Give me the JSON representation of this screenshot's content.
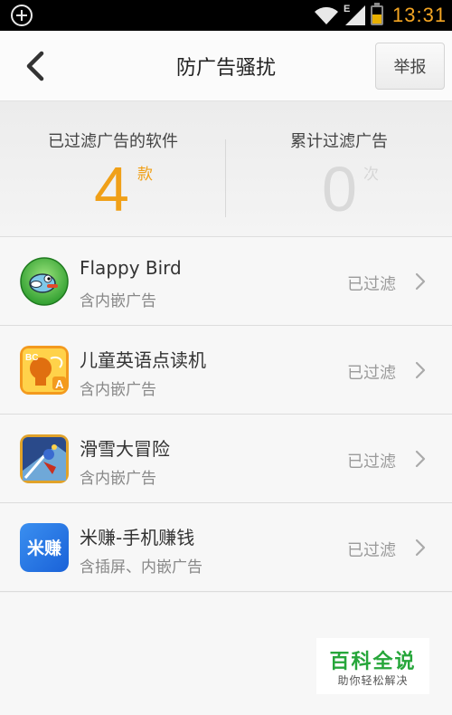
{
  "status_bar": {
    "time": "13:31",
    "network": "E"
  },
  "header": {
    "title": "防广告骚扰",
    "report_button": "举报"
  },
  "stats": {
    "filtered_apps": {
      "label": "已过滤广告的软件",
      "value": "4",
      "unit": "款"
    },
    "total_filtered": {
      "label": "累计过滤广告",
      "value": "0",
      "unit": "次"
    }
  },
  "apps": [
    {
      "name": "Flappy Bird",
      "ad_type": "含内嵌广告",
      "status": "已过滤",
      "icon": "flappy-bird-icon"
    },
    {
      "name": "儿童英语点读机",
      "ad_type": "含内嵌广告",
      "status": "已过滤",
      "icon": "kids-english-icon"
    },
    {
      "name": "滑雪大冒险",
      "ad_type": "含内嵌广告",
      "status": "已过滤",
      "icon": "ski-adventure-icon"
    },
    {
      "name": "米赚-手机赚钱",
      "ad_type": "含插屏、内嵌广告",
      "status": "已过滤",
      "icon": "mizhuan-icon"
    }
  ],
  "watermark": {
    "title": "百科全说",
    "subtitle": "助你轻松解决"
  },
  "colors": {
    "accent": "#f0a018",
    "muted_number": "#d9d9d9",
    "watermark_green": "#26a63a"
  }
}
